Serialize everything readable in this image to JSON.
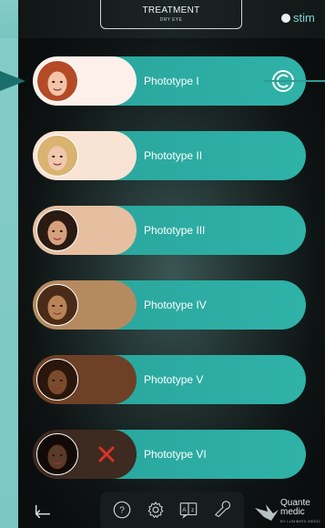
{
  "header": {
    "title": "TREATMENT",
    "subtitle": "DRY EYE",
    "logo_text": "stim"
  },
  "phototypes": [
    {
      "label": "Phototype I",
      "skin": "#fdf0ea",
      "face": "#f3c4a8",
      "hair": "#b54a26",
      "selected": true
    },
    {
      "label": "Phototype II",
      "skin": "#f9e3d5",
      "face": "#f0c8ad",
      "hair": "#d9b36f",
      "selected": false
    },
    {
      "label": "Phototype III",
      "skin": "#e6bfa1",
      "face": "#d7a07c",
      "hair": "#2a1a12",
      "selected": false
    },
    {
      "label": "Phototype IV",
      "skin": "#b58a5f",
      "face": "#b98358",
      "hair": "#4a2b17",
      "selected": false
    },
    {
      "label": "Phototype V",
      "skin": "#6e4026",
      "face": "#7a4a2c",
      "hair": "#2b160c",
      "selected": false
    },
    {
      "label": "Phototype VI",
      "skin": "#3d2a20",
      "face": "#5a3a28",
      "hair": "#120a06",
      "selected": false,
      "disabled": true
    }
  ],
  "toolbar": {
    "icons": [
      "help-icon",
      "settings-icon",
      "language-icon",
      "wrench-icon"
    ]
  },
  "brand": {
    "name_line1": "Quante",
    "name_line2": "medic",
    "tagline": "BY LUMIBIRD MEDIC"
  },
  "colors": {
    "accent": "#2fb2a8",
    "cancel": "#d9322b"
  }
}
